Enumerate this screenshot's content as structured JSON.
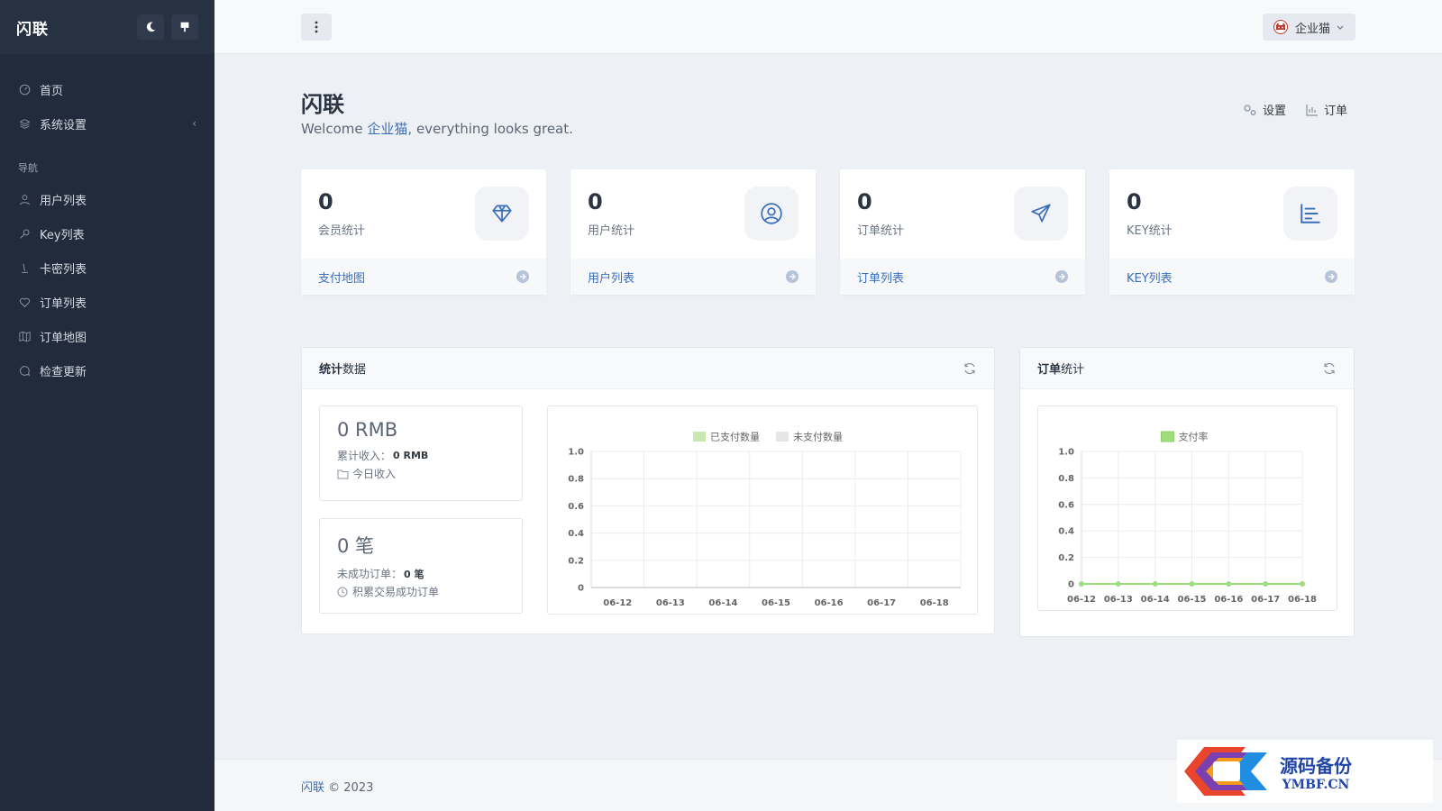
{
  "sidebar": {
    "brand": "闪联",
    "items_top": [
      {
        "label": "首页",
        "icon": "dashboard-icon"
      },
      {
        "label": "系统设置",
        "icon": "layers-icon"
      }
    ],
    "section_heading": "导航",
    "items_nav": [
      {
        "label": "用户列表",
        "icon": "user-icon"
      },
      {
        "label": "Key列表",
        "icon": "key-icon"
      },
      {
        "label": "卡密列表",
        "icon": "bell-icon"
      },
      {
        "label": "订单列表",
        "icon": "heart-icon"
      },
      {
        "label": "订单地图",
        "icon": "map-icon"
      },
      {
        "label": "检查更新",
        "icon": "chat-icon"
      }
    ]
  },
  "topbar": {
    "user_name": "企业猫"
  },
  "page": {
    "title": "闪联",
    "welcome_prefix": "Welcome ",
    "welcome_name": "企业猫",
    "welcome_suffix": ", everything looks great.",
    "link_settings": "设置",
    "link_orders": "订单"
  },
  "stats": [
    {
      "value": "0",
      "label": "会员统计",
      "footer": "支付地图",
      "icon": "diamond-icon"
    },
    {
      "value": "0",
      "label": "用户统计",
      "footer": "用户列表",
      "icon": "user-circle-icon"
    },
    {
      "value": "0",
      "label": "订单统计",
      "footer": "订单列表",
      "icon": "send-icon"
    },
    {
      "value": "0",
      "label": "KEY统计",
      "footer": "KEY列表",
      "icon": "bar-list-icon"
    }
  ],
  "stats_block": {
    "title_bold": "统计",
    "title_rest": "数据",
    "revenue_big": "0 RMB",
    "revenue_total_label": "累计收入：",
    "revenue_total_value": "0 RMB",
    "revenue_today_label": "今日收入",
    "orders_big": "0 笔",
    "orders_failed_label": "未成功订单：",
    "orders_failed_value": "0 笔",
    "orders_success_label": "积累交易成功订单"
  },
  "orders_block": {
    "title_bold": "订单",
    "title_rest": "统计"
  },
  "chart_data": [
    {
      "type": "bar",
      "categories": [
        "06-12",
        "06-13",
        "06-14",
        "06-15",
        "06-16",
        "06-17",
        "06-18"
      ],
      "series": [
        {
          "name": "已支付数量",
          "values": [
            0,
            0,
            0,
            0,
            0,
            0,
            0
          ],
          "color": "#c7e8b0"
        },
        {
          "name": "未支付数量",
          "values": [
            0,
            0,
            0,
            0,
            0,
            0,
            0
          ],
          "color": "#e6e6e6"
        }
      ],
      "yticks": [
        "1.0",
        "0.8",
        "0.6",
        "0.4",
        "0.2",
        "0"
      ],
      "ylim": [
        0,
        1.0
      ],
      "legend": "top-center",
      "grid": true
    },
    {
      "type": "line",
      "categories": [
        "06-12",
        "06-13",
        "06-14",
        "06-15",
        "06-16",
        "06-17",
        "06-18"
      ],
      "series": [
        {
          "name": "支付率",
          "values": [
            0,
            0,
            0,
            0,
            0,
            0,
            0
          ],
          "color": "#9fdc7e"
        }
      ],
      "yticks": [
        "1.0",
        "0.8",
        "0.6",
        "0.4",
        "0.2",
        "0"
      ],
      "ylim": [
        0,
        1.0
      ],
      "legend": "top-center",
      "grid": true
    }
  ],
  "footer": {
    "brand": "闪联",
    "copyright": " © 2023"
  },
  "watermark": {
    "cn": "源码备份",
    "en": "YMBF.CN"
  }
}
